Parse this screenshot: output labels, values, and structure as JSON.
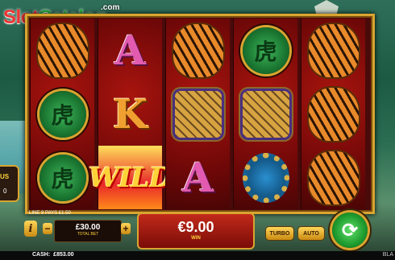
{
  "logo": {
    "part1": "Slot",
    "part2": "Catalog",
    "suffix": ".com"
  },
  "side_panel": {
    "label": "US",
    "value": "0"
  },
  "line_pays": "LINE 9 PAYS £1.50",
  "reels": [
    [
      "tiger",
      "medallion",
      "medallion"
    ],
    [
      "A",
      "K",
      "WILD"
    ],
    [
      "tiger",
      "tiger-gold",
      "A"
    ],
    [
      "medallion",
      "tiger-gold",
      "beads"
    ],
    [
      "tiger",
      "tiger",
      "tiger"
    ]
  ],
  "symbols": {
    "medallion_glyph": "虎",
    "wild": "WILD",
    "A": "A",
    "K": "K"
  },
  "controls": {
    "info": "i",
    "minus": "−",
    "plus": "+",
    "bet_value": "£30.00",
    "bet_label": "TOTAL BET",
    "win_value": "€9.00",
    "win_label": "WIN",
    "turbo": "TURBO",
    "auto": "AUTO",
    "spin_icon": "⟳"
  },
  "footer": {
    "cash_label": "CASH:",
    "cash_value": "£853.00",
    "brand": "BLA"
  },
  "colors": {
    "frame_gold": "#d9a530",
    "spin_green": "#1e9a2e",
    "win_red": "#c22a1a"
  }
}
